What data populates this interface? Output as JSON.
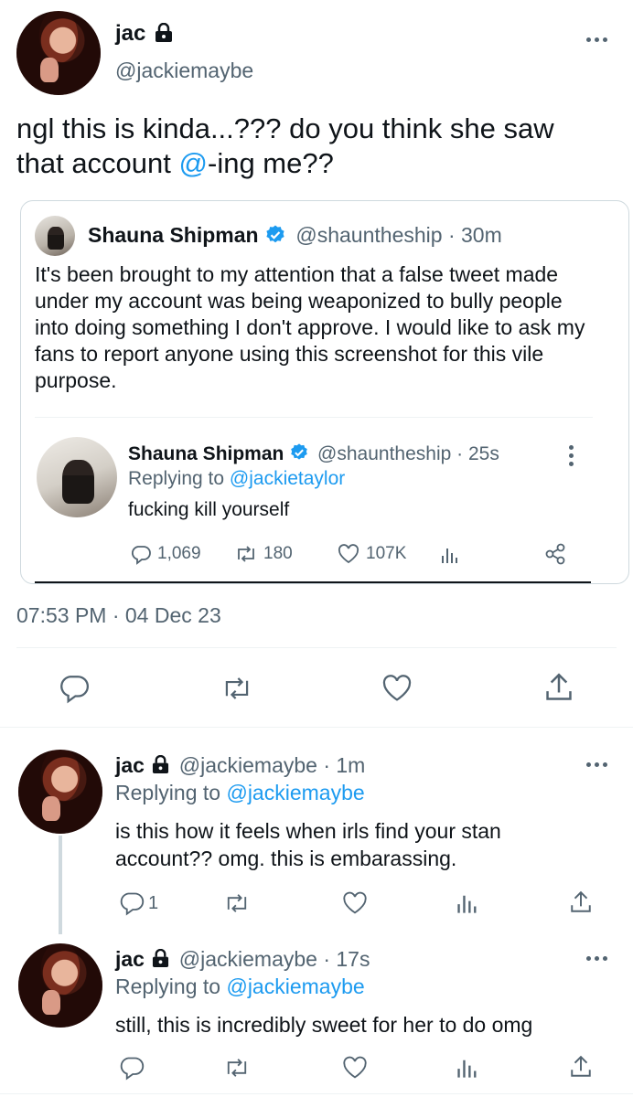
{
  "main_tweet": {
    "name": "jac",
    "handle": "@jackiemaybe",
    "text_before_mention": "ngl this is kinda...??? do you think she saw that account ",
    "text_mention": "@",
    "text_after_mention": "-ing me??",
    "timestamp": "07:53 PM · 04 Dec 23"
  },
  "quote": {
    "name": "Shauna Shipman",
    "handle": "@shauntheship",
    "time": "· 30m",
    "text": "It's been brought to my attention that a false tweet made under my account was being weaponized to bully people into doing something I don't approve. I would like to ask my fans to report anyone using this screenshot for this vile purpose.",
    "embedded": {
      "name": "Shauna Shipman",
      "handle": "@shauntheship",
      "time": "· 25s",
      "replying_prefix": "Replying to ",
      "replying_to": "@jackietaylor",
      "text": "fucking kill yourself",
      "replies": "1,069",
      "retweets": "180",
      "likes": "107K"
    }
  },
  "replies": [
    {
      "name": "jac",
      "handle": "@jackiemaybe",
      "time": "· 1m",
      "replying_prefix": "Replying to ",
      "replying_to": "@jackiemaybe",
      "text": "is this how it feels when irls find your stan account?? omg. this is embarassing.",
      "reply_count": "1"
    },
    {
      "name": "jac",
      "handle": "@jackiemaybe",
      "time": "· 17s",
      "replying_prefix": "Replying to ",
      "replying_to": "@jackiemaybe",
      "text": "still, this is incredibly sweet for her to do omg",
      "reply_count": ""
    }
  ],
  "colors": {
    "link": "#1d9bf0",
    "muted": "#536471",
    "verified": "#1d9bf0"
  },
  "icons": [
    "lock-icon",
    "more-icon",
    "verified-icon",
    "reply-icon",
    "retweet-icon",
    "like-icon",
    "share-icon",
    "analytics-icon"
  ]
}
